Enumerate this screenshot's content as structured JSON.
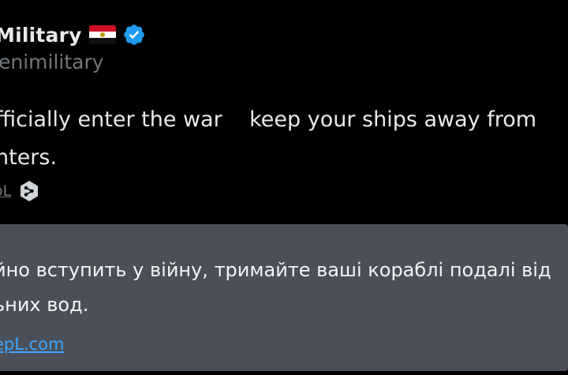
{
  "post": {
    "display_name": "Military",
    "handle": "enimilitary",
    "text_line_1": "fficially enter the war    keep your ships away from",
    "text_line_2": "nters.",
    "translate_link": "oL",
    "flag_colors": {
      "top": "#ce1126",
      "middle": "#ffffff",
      "bottom": "#111111",
      "emblem": "#c09300"
    },
    "verified_color": "#1d9bf0",
    "verified_icon": "verified-badge-icon",
    "deepl_icon": "deepl-logo-icon"
  },
  "translation": {
    "line_1": "йно вступить у війну, тримайте ваші кораблі подалі від",
    "line_2": "ьних вод.",
    "source_link": "epL.com",
    "panel_color": "#4b5058",
    "link_color": "#3ea6ff"
  }
}
